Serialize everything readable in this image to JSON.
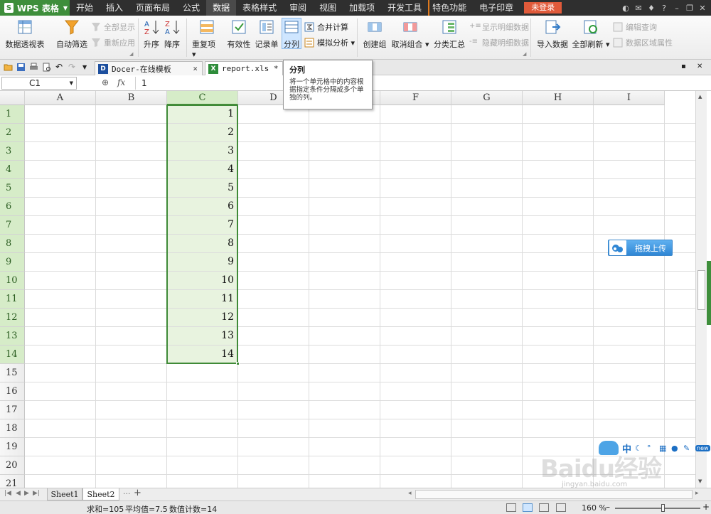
{
  "app": {
    "name": "WPS 表格",
    "logo_letter": "S",
    "login": "未登录"
  },
  "menu": [
    "开始",
    "插入",
    "页面布局",
    "公式",
    "数据",
    "表格样式",
    "审阅",
    "视图",
    "加载项",
    "开发工具",
    "特色功能",
    "电子印章"
  ],
  "ribbon": {
    "pivot": "数据透视表",
    "autofilter": "自动筛选",
    "show_all": "全部显示",
    "reapply": "重新应用",
    "sort_asc": "升序",
    "sort_desc": "降序",
    "duplicates": "重复项",
    "validity": "有效性",
    "record": "记录单",
    "split": "分列",
    "consolidate": "合并计算",
    "whatif": "模拟分析",
    "group": "创建组",
    "ungroup": "取消组合",
    "subtotal": "分类汇总",
    "show_detail": "显示明细数据",
    "hide_detail": "隐藏明细数据",
    "import": "导入数据",
    "refresh_all": "全部刷新",
    "edit_query": "编辑查询",
    "range_props": "数据区域属性"
  },
  "tabs": [
    {
      "label": "Docer-在线模板",
      "close": "×"
    },
    {
      "label": "report.xls *"
    }
  ],
  "formula_bar": {
    "cell": "C1",
    "fx": "fx",
    "value": "1"
  },
  "tooltip": {
    "title": "分列",
    "body": "将一个单元格中的内容根据指定条件分隔成多个单独的列。"
  },
  "columns": [
    "A",
    "B",
    "C",
    "D",
    "E",
    "F",
    "G",
    "H",
    "I"
  ],
  "selected_column": "C",
  "rows": [
    "1",
    "2",
    "3",
    "4",
    "5",
    "6",
    "7",
    "8",
    "9",
    "10",
    "11",
    "12",
    "13",
    "14",
    "15",
    "16",
    "17",
    "18",
    "19",
    "20",
    "21"
  ],
  "column_c_values": [
    "1",
    "2",
    "3",
    "4",
    "5",
    "6",
    "7",
    "8",
    "9",
    "10",
    "11",
    "12",
    "13",
    "14"
  ],
  "upload_button": "拖拽上传",
  "sheets": [
    "Sheet1",
    "Sheet2"
  ],
  "active_sheet": "Sheet2",
  "sheet_more": "···",
  "sheet_add": "+",
  "status": {
    "sum": "求和=105",
    "avg": "平均值=7.5",
    "count": "数值计数=14",
    "zoom": "160 %"
  },
  "ime": {
    "mode": "中",
    "badge": "new"
  },
  "watermark": {
    "brand": "Baidu经验",
    "url": "jingyan.baidu.com"
  },
  "colors": {
    "accent_green": "#3e8e3b",
    "selection": "#d6ecc8",
    "login": "#e05a3a"
  }
}
